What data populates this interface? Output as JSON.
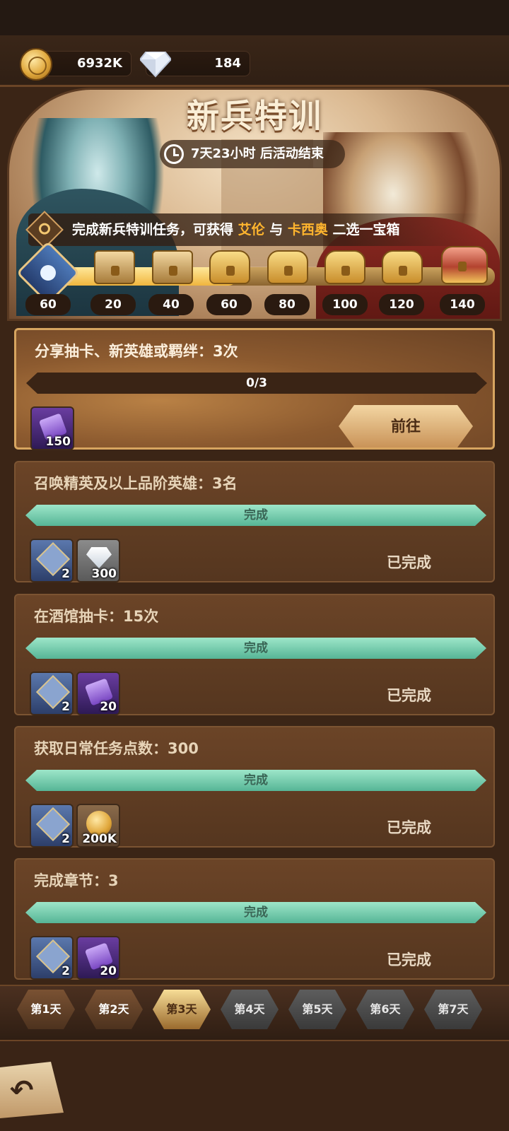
{
  "currency": {
    "gold": "6932K",
    "gems": "184"
  },
  "event": {
    "title": "新兵特训",
    "timer": "7天23小时 后活动结束",
    "desc_prefix": "完成新兵特训任务，可获得 ",
    "hero1": "艾伦",
    "desc_mid": " 与 ",
    "hero2": "卡西奥",
    "desc_suffix": " 二选一宝箱"
  },
  "progress": {
    "current": "60",
    "fill_fraction": 0.42,
    "milestones": [
      "20",
      "40",
      "60",
      "80",
      "100",
      "120",
      "140"
    ]
  },
  "tasks": [
    {
      "title": "分享抽卡、新英雄或羁绊：3次",
      "progress": "0/3",
      "reward1_qty": "150",
      "action": "前往"
    },
    {
      "title": "召唤精英及以上品阶英雄：3名",
      "progress": "完成",
      "reward1_qty": "2",
      "reward2_qty": "300",
      "status": "已完成"
    },
    {
      "title": "在酒馆抽卡：15次",
      "progress": "完成",
      "reward1_qty": "2",
      "reward2_qty": "20",
      "status": "已完成"
    },
    {
      "title": "获取日常任务点数：300",
      "progress": "完成",
      "reward1_qty": "2",
      "reward2_qty": "200K",
      "status": "已完成"
    },
    {
      "title": "完成章节：3",
      "progress": "完成",
      "reward1_qty": "2",
      "reward2_qty": "20",
      "status": "已完成"
    }
  ],
  "days": [
    "第1天",
    "第2天",
    "第3天",
    "第4天",
    "第5天",
    "第6天",
    "第7天"
  ],
  "current_day": "第3天"
}
